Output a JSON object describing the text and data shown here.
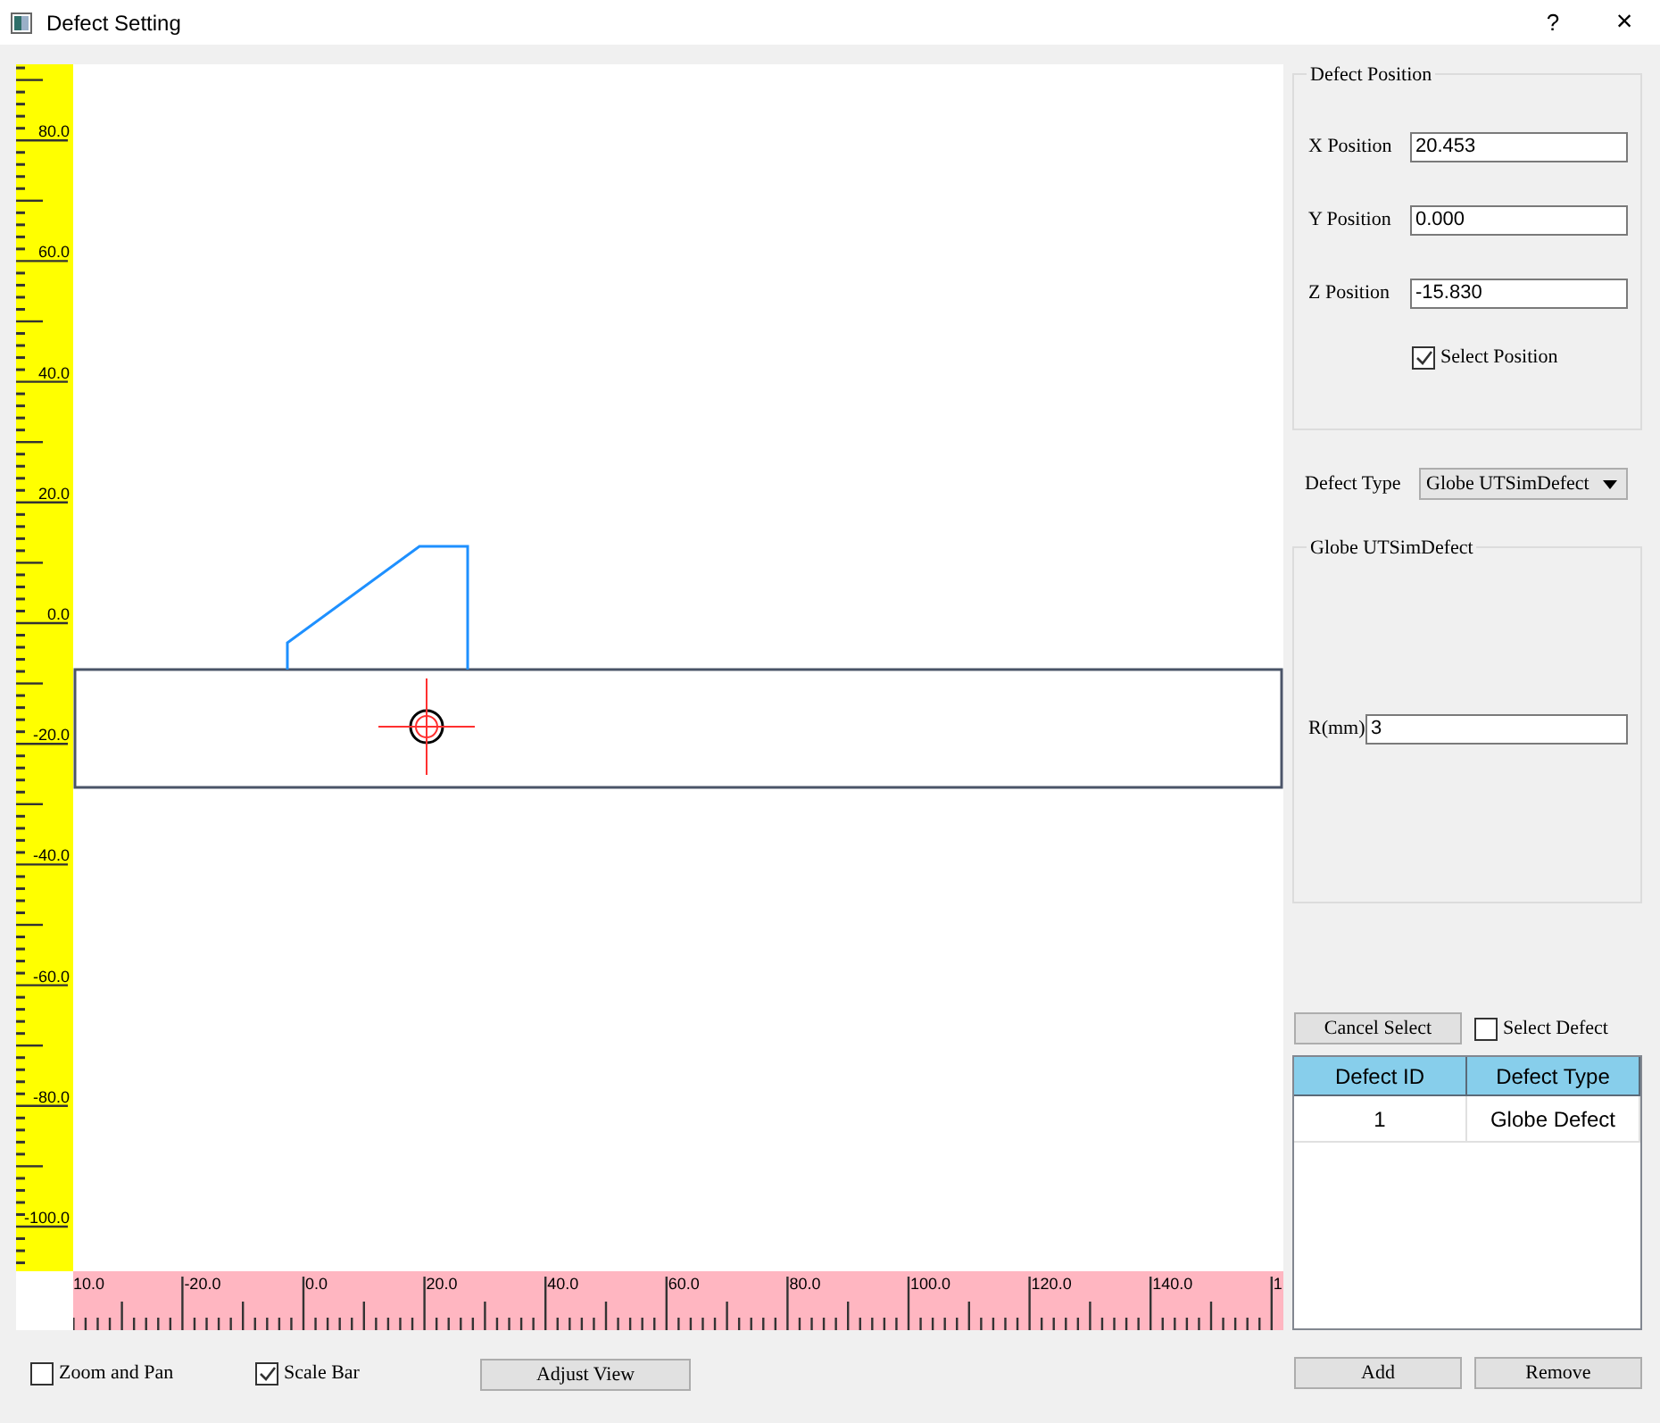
{
  "window": {
    "title": "Defect Setting",
    "help_button": "?",
    "close_button": "×"
  },
  "vertical_ruler": {
    "labels": [
      "80.0",
      "60.0",
      "40.0",
      "20.0",
      "0.0",
      "-20.0",
      "-40.0",
      "-60.0",
      "-80.0",
      "-100.0"
    ]
  },
  "horizontal_ruler": {
    "labels": [
      "10.0",
      "-20.0",
      "0.0",
      "20.0",
      "40.0",
      "60.0",
      "80.0",
      "100.0",
      "120.0",
      "140.0",
      "1"
    ]
  },
  "defect_position": {
    "title": "Defect Position",
    "fields": [
      {
        "label": "X Position",
        "value": "20.453"
      },
      {
        "label": "Y Position",
        "value": "0.000"
      },
      {
        "label": "Z Position",
        "value": "-15.830"
      }
    ],
    "select_position": {
      "label": "Select Position",
      "checked": true
    }
  },
  "defect_type": {
    "label": "Defect Type",
    "value": "Globe UTSimDefect"
  },
  "globe_group": {
    "title": "Globe UTSimDefect",
    "fields": [
      {
        "label": "R(mm)",
        "value": "3"
      }
    ]
  },
  "cancel_select": "Cancel Select",
  "select_defect": {
    "label": "Select Defect",
    "checked": false
  },
  "table": {
    "columns": [
      "Defect ID",
      "Defect Type"
    ],
    "rows": [
      [
        "1",
        "Globe Defect"
      ]
    ]
  },
  "buttons": [
    "Add",
    "Remove"
  ],
  "bottom_bar": {
    "zoom_and_pan": {
      "label": "Zoom and Pan",
      "checked": false
    },
    "scale_bar": {
      "label": "Scale Bar",
      "checked": true
    },
    "adjust_view": "Adjust View"
  }
}
